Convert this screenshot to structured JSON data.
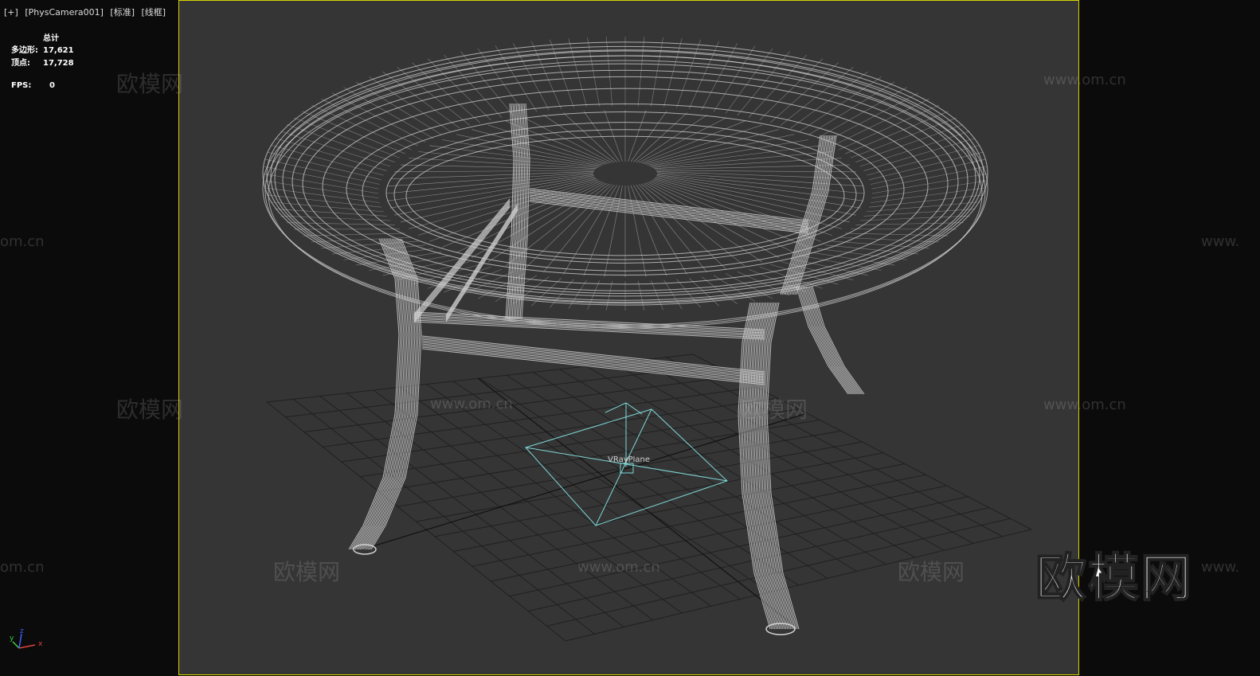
{
  "viewport": {
    "label_parts": [
      "[+]",
      "[PhysCamera001]",
      "[标准]",
      "[线框]"
    ]
  },
  "stats": {
    "header": "总计",
    "polygons_label": "多边形:",
    "polygons_value": "17,621",
    "vertices_label": "顶点:",
    "vertices_value": "17,728",
    "fps_label": "FPS:",
    "fps_value": "0"
  },
  "scene": {
    "object_label": "VRayPlane",
    "wire_color": "#d4d4d4",
    "grid_color": "#202020",
    "vray_color": "#7fd6d6"
  },
  "axis_gizmo": {
    "x": "x",
    "y": "y",
    "z": "z"
  },
  "watermarks": {
    "logo_text": "欧模网",
    "url_text": "www.om.cn",
    "short_url": "om.cn",
    "short_www": "www."
  },
  "colors": {
    "viewport_bg": "#353535",
    "frame_border": "#d8d200",
    "outside_bg": "#0b0b0b"
  }
}
